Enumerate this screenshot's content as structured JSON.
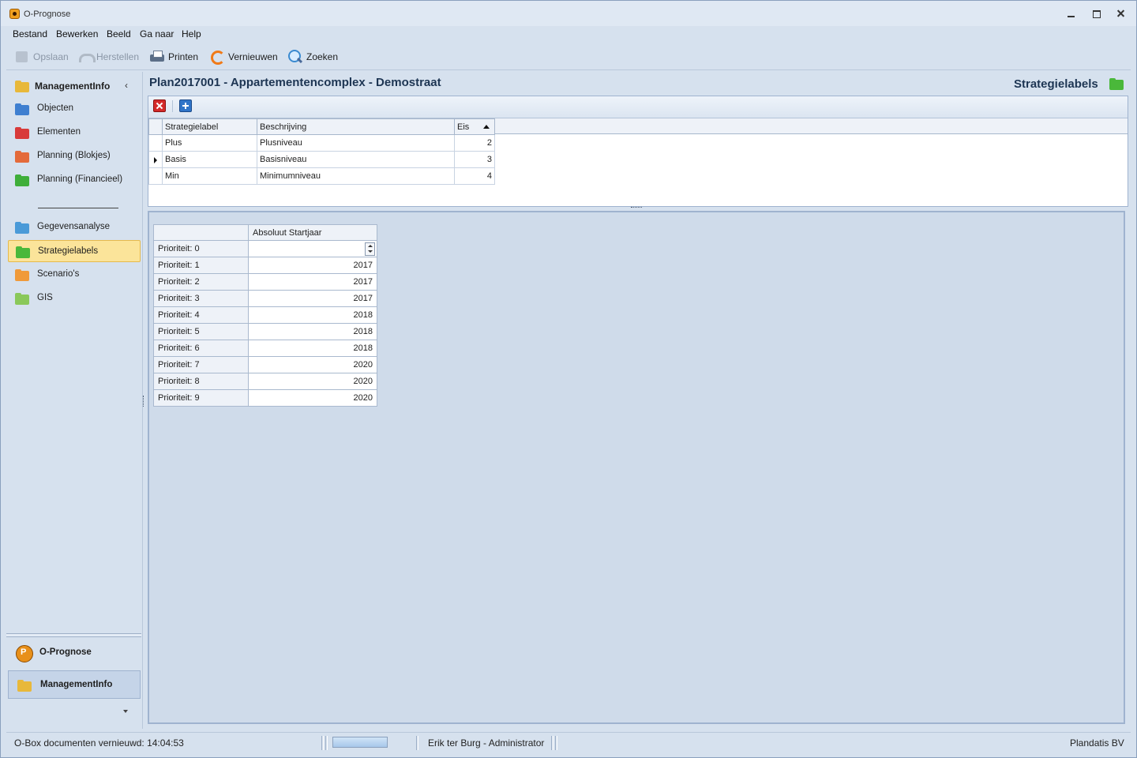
{
  "window": {
    "title": "O-Prognose"
  },
  "menu": [
    "Bestand",
    "Bewerken",
    "Beeld",
    "Ga naar",
    "Help"
  ],
  "toolbar": {
    "save": "Opslaan",
    "restore": "Herstellen",
    "print": "Printen",
    "refresh": "Vernieuwen",
    "search": "Zoeken"
  },
  "nav": {
    "header": "ManagementInfo",
    "items": [
      {
        "label": "Objecten",
        "icon": "folder-blue-icon"
      },
      {
        "label": "Elementen",
        "icon": "folder-red-icon"
      },
      {
        "label": "Planning (Blokjes)",
        "icon": "folder-calendar-icon"
      },
      {
        "label": "Planning (Financieel)",
        "icon": "folder-calendar-icon"
      },
      {
        "label": "Gegevensanalyse",
        "icon": "database-icon"
      },
      {
        "label": "Strategielabels",
        "icon": "folder-green-icon",
        "active": true
      },
      {
        "label": "Scenario's",
        "icon": "folder-orange-icon"
      },
      {
        "label": "GIS",
        "icon": "map-icon"
      }
    ],
    "modules": [
      {
        "label": "O-Prognose",
        "icon": "o-prognose-icon"
      },
      {
        "label": "ManagementInfo",
        "icon": "folder-icon",
        "selected": true
      }
    ]
  },
  "content": {
    "title": "Plan2017001 - Appartementencomplex - Demostraat",
    "section_title": "Strategielabels"
  },
  "labels_grid": {
    "columns": [
      "Strategielabel",
      "Beschrijving",
      "Eis"
    ],
    "sort_column": "Eis",
    "rows": [
      {
        "label": "Plus",
        "description": "Plusniveau",
        "eis": "2"
      },
      {
        "label": "Basis",
        "description": "Basisniveau",
        "eis": "3",
        "current": true
      },
      {
        "label": "Min",
        "description": "Minimumniveau",
        "eis": "4"
      }
    ]
  },
  "priority_grid": {
    "column": "Absoluut Startjaar",
    "rows": [
      {
        "label": "Prioriteit: 0",
        "value": ""
      },
      {
        "label": "Prioriteit: 1",
        "value": "2017"
      },
      {
        "label": "Prioriteit: 2",
        "value": "2017"
      },
      {
        "label": "Prioriteit: 3",
        "value": "2017"
      },
      {
        "label": "Prioriteit: 4",
        "value": "2018"
      },
      {
        "label": "Prioriteit: 5",
        "value": "2018"
      },
      {
        "label": "Prioriteit: 6",
        "value": "2018"
      },
      {
        "label": "Prioriteit: 7",
        "value": "2020"
      },
      {
        "label": "Prioriteit: 8",
        "value": "2020"
      },
      {
        "label": "Prioriteit: 9",
        "value": "2020"
      }
    ]
  },
  "status": {
    "left": "O-Box documenten vernieuwd: 14:04:53",
    "user": "Erik ter Burg - Administrator",
    "company": "Plandatis BV"
  }
}
